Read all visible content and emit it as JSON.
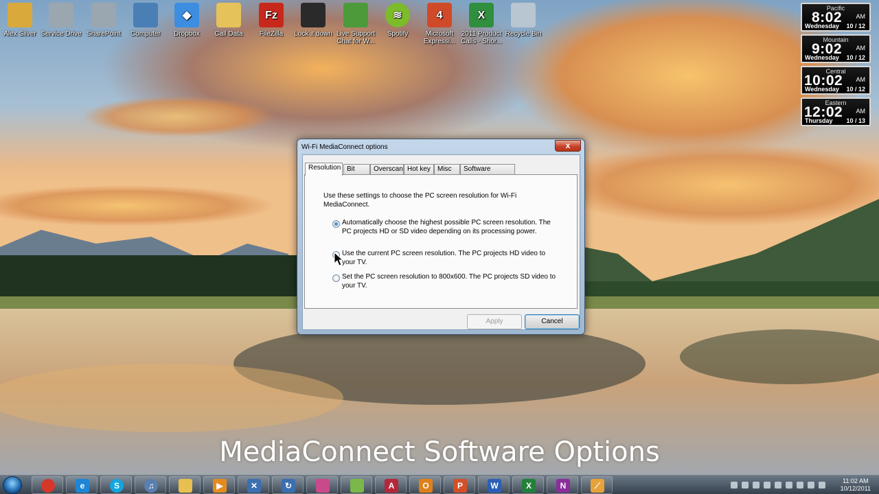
{
  "desktop": {
    "icons": [
      {
        "label": "Alex Silver",
        "icon": "user-folder-icon",
        "color": "#d9a93b"
      },
      {
        "label": "Service Drive",
        "icon": "network-drive-icon",
        "color": "#9aa6b0"
      },
      {
        "label": "SharePoint",
        "icon": "network-drive-icon",
        "color": "#9aa6b0"
      },
      {
        "label": "Computer",
        "icon": "computer-icon",
        "color": "#4a7fb5"
      },
      {
        "label": "Dropbox",
        "icon": "dropbox-icon",
        "color": "#3d8de0"
      },
      {
        "label": "Call Data",
        "icon": "folder-icon",
        "color": "#e6c25a"
      },
      {
        "label": "FileZilla",
        "icon": "filezilla-icon",
        "color": "#c8281c"
      },
      {
        "label": "Lock it down",
        "icon": "lock-screen-icon",
        "color": "#2a2a2a"
      },
      {
        "label": "Live Support Chat for W...",
        "icon": "people-icon",
        "color": "#4b9b3a"
      },
      {
        "label": "Spotify",
        "icon": "spotify-icon",
        "color": "#7cbb2a"
      },
      {
        "label": "Microsoft Expressi...",
        "icon": "expression-icon",
        "color": "#d04a2a"
      },
      {
        "label": "2011 Product Calls - Shor...",
        "icon": "excel-file-icon",
        "color": "#2f8f3e"
      },
      {
        "label": "Recycle Bin",
        "icon": "recycle-bin-icon",
        "color": "#b8c6d2"
      }
    ]
  },
  "clocks": [
    {
      "zone": "Pacific",
      "time": "8:02",
      "ampm": "AM",
      "day": "Wednesday",
      "date": "10 / 12"
    },
    {
      "zone": "Mountain",
      "time": "9:02",
      "ampm": "AM",
      "day": "Wednesday",
      "date": "10 / 12"
    },
    {
      "zone": "Central",
      "time": "10:02",
      "ampm": "AM",
      "day": "Wednesday",
      "date": "10 / 12"
    },
    {
      "zone": "Eastern",
      "time": "12:02",
      "ampm": "AM",
      "day": "Thursday",
      "date": "10 / 13"
    }
  ],
  "dialog": {
    "title": "Wi-Fi MediaConnect options",
    "close_label": "x",
    "tabs": [
      "Resolution",
      "Bit rate",
      "Overscan",
      "Hot key",
      "Misc",
      "Software update"
    ],
    "active_tab": "Resolution",
    "intro": "Use these settings to choose the PC screen resolution for Wi-Fi MediaConnect.",
    "options": [
      {
        "text": "Automatically choose the highest possible PC screen resolution. The PC projects HD or SD video depending on its processing power.",
        "selected": true
      },
      {
        "text": "Use the current PC screen resolution. The PC projects HD video to your TV.",
        "selected": false
      },
      {
        "text": "Set the PC screen resolution to 800x600. The PC projects SD video to your TV.",
        "selected": false
      }
    ],
    "apply_label": "Apply",
    "cancel_label": "Cancel"
  },
  "caption": "MediaConnect Software Options",
  "taskbar": {
    "apps": [
      {
        "icon": "chrome-icon",
        "color": "#d6372b",
        "glyph": ""
      },
      {
        "icon": "internet-explorer-icon",
        "color": "#1f86d6",
        "glyph": "e"
      },
      {
        "icon": "skype-icon",
        "color": "#12a5e0",
        "glyph": "S"
      },
      {
        "icon": "itunes-icon",
        "color": "#5a7fb0",
        "glyph": "♫"
      },
      {
        "icon": "file-explorer-icon",
        "color": "#e8c050",
        "glyph": ""
      },
      {
        "icon": "media-player-icon",
        "color": "#e58a1f",
        "glyph": "▶"
      },
      {
        "icon": "remote-app-icon",
        "color": "#3b6fb0",
        "glyph": "✕"
      },
      {
        "icon": "sync-app-icon",
        "color": "#3b6fb0",
        "glyph": "↻"
      },
      {
        "icon": "paint-icon",
        "color": "#c84a8a",
        "glyph": ""
      },
      {
        "icon": "folder-app-icon",
        "color": "#7ab84a",
        "glyph": ""
      },
      {
        "icon": "access-icon",
        "color": "#b5273a",
        "glyph": "A"
      },
      {
        "icon": "outlook-icon",
        "color": "#e0801a",
        "glyph": "O"
      },
      {
        "icon": "powerpoint-icon",
        "color": "#d2502a",
        "glyph": "P"
      },
      {
        "icon": "word-icon",
        "color": "#2b5fb5",
        "glyph": "W"
      },
      {
        "icon": "excel-icon",
        "color": "#22803a",
        "glyph": "X"
      },
      {
        "icon": "onenote-icon",
        "color": "#8a2e9a",
        "glyph": "N"
      },
      {
        "icon": "mediaconnect-icon",
        "color": "#e8a23a",
        "glyph": "⟋"
      }
    ],
    "tray_time": "11:02 AM",
    "tray_date": "10/12/2011"
  }
}
